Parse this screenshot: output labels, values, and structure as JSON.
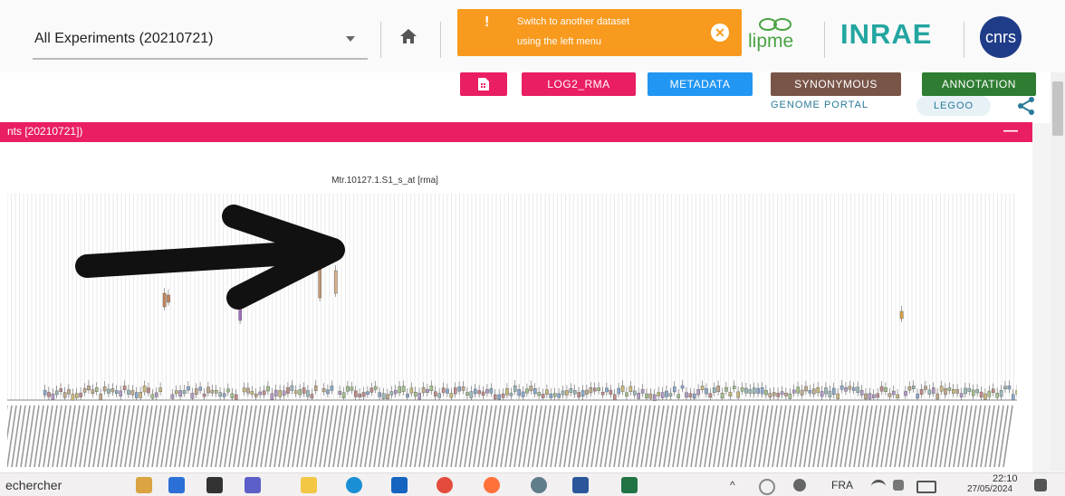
{
  "header": {
    "dataset_select_value": "All Experiments (20210721)",
    "toast": {
      "icon": "!",
      "line1": "Switch to another dataset",
      "line2": "using the left menu",
      "close_icon": "✕"
    },
    "logos": {
      "lipme": "lipme",
      "inrae": "INRAE",
      "cnrs": "cnrs"
    }
  },
  "toolbar": {
    "log2_rma": "LOG2_RMA",
    "metadata": "METADATA",
    "synonymous": "SYNONYMOUS",
    "annotation": "ANNOTATION",
    "genome_portal": "GENOME PORTAL",
    "legoo": "LEGOO"
  },
  "colors": {
    "pink": "#e91e63",
    "blue": "#2196f3",
    "brown": "#795548",
    "green": "#2e7d32",
    "orange": "#f89a1e"
  },
  "panel": {
    "title": "nts [20210721])",
    "minimize": "—"
  },
  "chart_data": {
    "type": "box",
    "title": "Mtr.10127.1.S1_s_at  [rma]",
    "xlabel": "",
    "ylabel": ""
  },
  "taskbar": {
    "search_text": "echercher",
    "lang": "FRA",
    "time": "22:10",
    "date": "27/05/2024"
  }
}
